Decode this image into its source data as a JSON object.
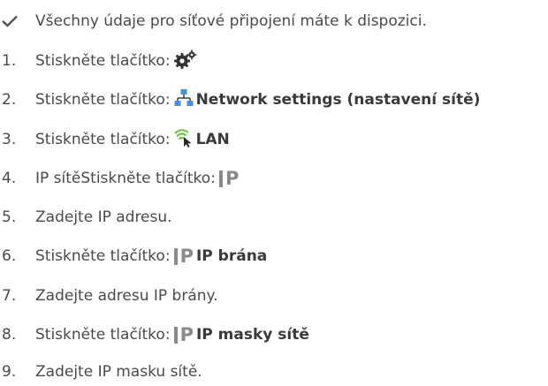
{
  "intro": "Všechny údaje pro síťové připojení máte k dispozici.",
  "steps": [
    {
      "num": "1.",
      "text": "Stiskněte tlačítko:",
      "icon": "gear-icon"
    },
    {
      "num": "2.",
      "text": "Stiskněte tlačítko:",
      "icon": "network-icon",
      "bold": "Network settings (nastavení sítě)"
    },
    {
      "num": "3.",
      "text": "Stiskněte tlačítko:",
      "icon": "wifi-cursor-icon",
      "bold": "LAN"
    },
    {
      "num": "4.",
      "text": "IP sítěStiskněte tlačítko:",
      "icon": "ip-icon"
    },
    {
      "num": "5.",
      "text": "Zadejte IP adresu."
    },
    {
      "num": "6.",
      "text": "Stiskněte tlačítko:",
      "icon": "ip-icon",
      "bold": "IP brána"
    },
    {
      "num": "7.",
      "text": "Zadejte adresu IP brány."
    },
    {
      "num": "8.",
      "text": "Stiskněte tlačítko:",
      "icon": "ip-icon",
      "bold": "IP masky sítě"
    },
    {
      "num": "9.",
      "text": "Zadejte IP masku sítě."
    }
  ],
  "icon_glyphs": {
    "ip": "P"
  },
  "colors": {
    "text": "#4a4a4a",
    "icon_gray": "#8a8a8a",
    "network_blue": "#4a90d9",
    "wifi_green": "#6cbf3c"
  }
}
